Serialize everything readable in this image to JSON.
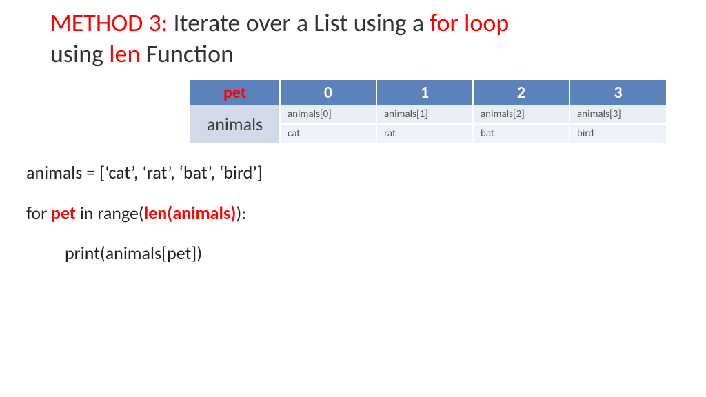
{
  "title": {
    "method_prefix": "METHOD 3:",
    "part1": " Iterate over a List using a ",
    "for_loop": "for loop",
    "part2": "using ",
    "len": "len",
    "part3": " Function"
  },
  "table": {
    "col0_header": "pet",
    "indices": [
      "0",
      "1",
      "2",
      "3"
    ],
    "row_label": "animals",
    "refs": [
      "animals[0]",
      "animals[1]",
      "animals[2]",
      "animals[3]"
    ],
    "vals": [
      "cat",
      "rat",
      "bat",
      "bird"
    ]
  },
  "code": {
    "line1": "animals = [‘cat’, ‘rat’, ‘bat’, ‘bird’]",
    "line2_pre": "for ",
    "line2_var": "pet",
    "line2_mid": " in range(",
    "line2_len": "len(animals)",
    "line2_post": "):",
    "line3": "print(animals[pet])"
  }
}
